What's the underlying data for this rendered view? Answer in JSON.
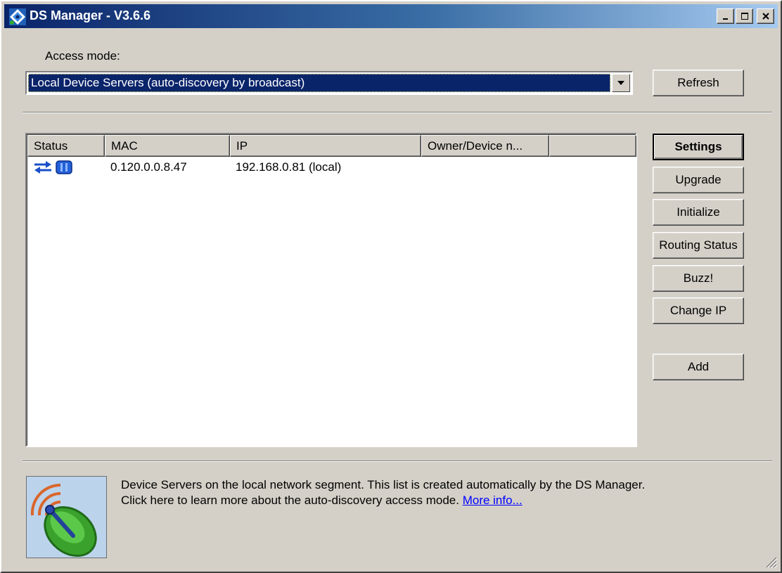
{
  "window": {
    "title": "DS Manager - V3.6.6"
  },
  "access_mode": {
    "label": "Access mode:",
    "selected": "Local Device Servers (auto-discovery by broadcast)"
  },
  "buttons": {
    "refresh": "Refresh",
    "settings": "Settings",
    "upgrade": "Upgrade",
    "initialize": "Initialize",
    "routing_status": "Routing Status",
    "buzz": "Buzz!",
    "change_ip": "Change IP",
    "add": "Add"
  },
  "table": {
    "columns": [
      "Status",
      "MAC",
      "IP",
      "Owner/Device n..."
    ],
    "rows": [
      {
        "status_icons": [
          "transfer-arrows-icon",
          "device-icon"
        ],
        "mac": "0.120.0.0.8.47",
        "ip": "192.168.0.81 (local)",
        "owner": ""
      }
    ]
  },
  "info": {
    "line1": "Device Servers on the local network segment. This list is created automatically by the DS Manager.",
    "line2": "Click here to learn more about the auto-discovery access mode.",
    "link": "More info...",
    "icon": "satellite-dish-icon"
  },
  "colors": {
    "titlebar_start": "#0a246a",
    "titlebar_end": "#a6caf0",
    "selection": "#0a246a",
    "face": "#d4d0c8",
    "link": "#0000ff"
  }
}
